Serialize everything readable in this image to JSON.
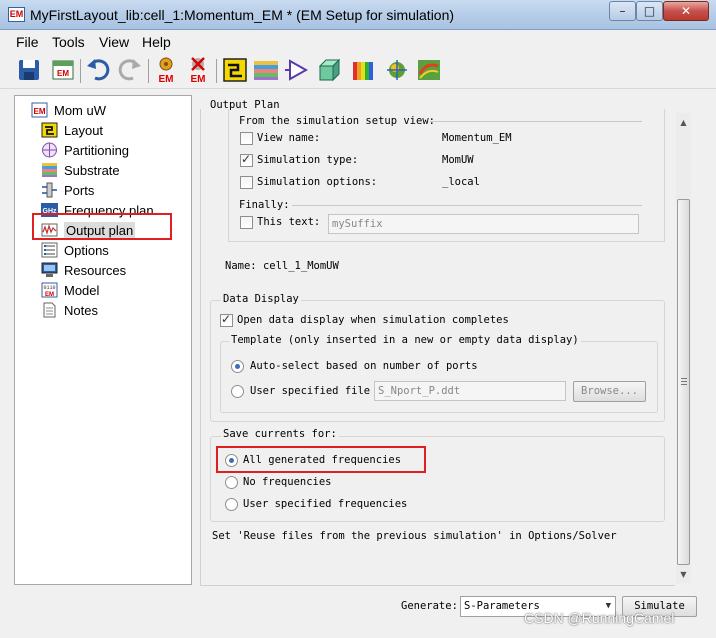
{
  "window": {
    "title": "MyFirstLayout_lib:cell_1:Momentum_EM * (EM Setup for simulation)",
    "app_icon_text": "EM",
    "minimize": "–",
    "maximize": "□",
    "close": "✕"
  },
  "menu": {
    "items": [
      "File",
      "Tools",
      "View",
      "Help"
    ]
  },
  "toolbar": {
    "icons": [
      "save-icon",
      "em-view-icon",
      "undo-icon",
      "redo-icon",
      "em-simulate-icon",
      "em-stop-icon",
      "schematic-icon",
      "substrate-layers-icon",
      "component-icon",
      "3d-box-icon",
      "3d-view-icon",
      "mesh-icon",
      "far-field-icon"
    ]
  },
  "tree": {
    "root_label": "Mom uW",
    "items": [
      {
        "label": "Layout",
        "icon": "layout-icon"
      },
      {
        "label": "Partitioning",
        "icon": "partitioning-icon"
      },
      {
        "label": "Substrate",
        "icon": "substrate-icon"
      },
      {
        "label": "Ports",
        "icon": "ports-icon"
      },
      {
        "label": "Frequency plan",
        "icon": "frequency-plan-icon"
      },
      {
        "label": "Output plan",
        "icon": "output-plan-icon",
        "selected": true
      },
      {
        "label": "Options",
        "icon": "options-icon"
      },
      {
        "label": "Resources",
        "icon": "resources-icon"
      },
      {
        "label": "Model",
        "icon": "model-icon"
      },
      {
        "label": "Notes",
        "icon": "notes-icon"
      }
    ]
  },
  "output_plan": {
    "heading": "Output Plan",
    "from_view_label": "From the simulation setup view:",
    "view_name_label": "View name:",
    "view_name_value": "Momentum_EM",
    "view_name_checked": false,
    "sim_type_label": "Simulation type:",
    "sim_type_value": "MomUW",
    "sim_type_checked": true,
    "sim_options_label": "Simulation options:",
    "sim_options_value": "_local",
    "sim_options_checked": false,
    "finally_label": "Finally:",
    "this_text_label": "This text:",
    "this_text_checked": false,
    "this_text_value": "mySuffix",
    "name_label": "Name:",
    "name_value": "cell_1_MomUW"
  },
  "data_display": {
    "title": "Data Display",
    "open_label": "Open data display when simulation completes",
    "open_checked": true,
    "template_title": "Template (only inserted in a new or empty data display)",
    "auto_select_label": "Auto-select based on number of ports",
    "auto_select_checked": true,
    "user_file_label": "User specified file",
    "user_file_value": "S_Nport_P.ddt",
    "browse_label": "Browse..."
  },
  "save_currents": {
    "title": "Save currents for:",
    "options": [
      {
        "label": "All generated frequencies",
        "checked": true
      },
      {
        "label": "No frequencies",
        "checked": false
      },
      {
        "label": "User specified frequencies",
        "checked": false
      }
    ],
    "note": "Set 'Reuse files from the previous simulation' in Options/Solver"
  },
  "bottom": {
    "generate_label": "Generate:",
    "generate_value": "S-Parameters",
    "simulate_label": "Simulate"
  },
  "scrollbar": {
    "up_arrow": "▲",
    "down_arrow": "▼"
  },
  "watermark": "CSDN @RunningCamel",
  "colors": {
    "highlight_box": "#e02020",
    "selected_radio": "#3a6fb8",
    "titlebar": "#b6cde8"
  }
}
